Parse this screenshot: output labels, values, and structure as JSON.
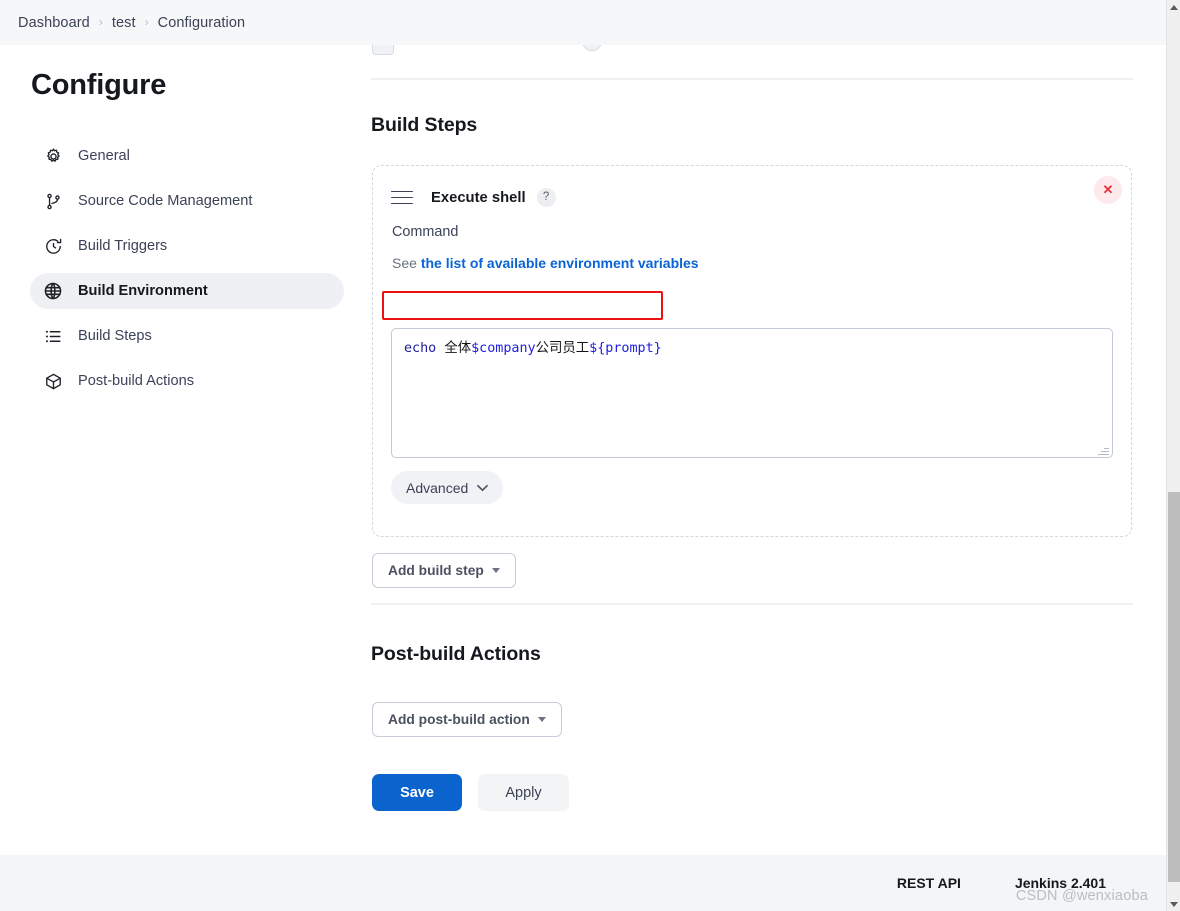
{
  "breadcrumb": {
    "items": [
      {
        "label": "Dashboard",
        "icon": "none"
      },
      {
        "label": "test",
        "icon": "none"
      },
      {
        "label": "Configuration",
        "icon": "none"
      }
    ],
    "separator": "›"
  },
  "sidebar": {
    "title": "Configure",
    "items": [
      {
        "label": "General",
        "icon": "gear-icon",
        "active": false
      },
      {
        "label": "Source Code Management",
        "icon": "git-branch-icon",
        "active": false
      },
      {
        "label": "Build Triggers",
        "icon": "clock-icon",
        "active": false
      },
      {
        "label": "Build Environment",
        "icon": "globe-icon",
        "active": true
      },
      {
        "label": "Build Steps",
        "icon": "list-icon",
        "active": false
      },
      {
        "label": "Post-build Actions",
        "icon": "package-icon",
        "active": false
      }
    ]
  },
  "main": {
    "build_steps": {
      "heading": "Build Steps",
      "step": {
        "drag_handle_icon": "hamburger-drag-icon",
        "name": "Execute shell",
        "help_badge": "?",
        "close_icon": "✕",
        "command_label": "Command",
        "env_prefix": "See",
        "env_link": "the list of available environment variables",
        "command_value": "echo 全体$company公司员工${prompt}",
        "command_tokens": [
          {
            "text": "echo ",
            "kind": "keyword"
          },
          {
            "text": "全体",
            "kind": "text"
          },
          {
            "text": "$company",
            "kind": "variable"
          },
          {
            "text": "公司员工",
            "kind": "text"
          },
          {
            "text": "${prompt}",
            "kind": "variable"
          }
        ],
        "command_placeholder": "",
        "advanced_label": "Advanced",
        "advanced_caret_icon": "chevron-down-icon"
      },
      "add_step_label": "Add build step",
      "add_step_caret_icon": "caret-down-icon"
    },
    "post_build": {
      "heading": "Post-build Actions",
      "add_action_label": "Add post-build action",
      "add_action_caret_icon": "caret-down-icon"
    },
    "actions": {
      "save_label": "Save",
      "apply_label": "Apply"
    }
  },
  "footer": {
    "rest_api_label": "REST API",
    "version_label": "Jenkins 2.401",
    "watermark": "CSDN @wenxiaoba"
  },
  "annotation": {
    "type": "red-rectangle-highlight",
    "target": "command-input-first-line",
    "color": "#ee1111"
  },
  "colors": {
    "accent_blue": "#0b63ce",
    "link_blue": "#0b64d4",
    "danger_red": "#e8333f",
    "annotation_red": "#ee1111",
    "bar_background": "#f6f7f9",
    "footer_background": "#f4f5f7",
    "active_item_background": "#eff0f4"
  },
  "scrollbar": {
    "up_icon": "triangle-up-icon",
    "down_icon": "triangle-down-icon",
    "position_percent": 57
  }
}
